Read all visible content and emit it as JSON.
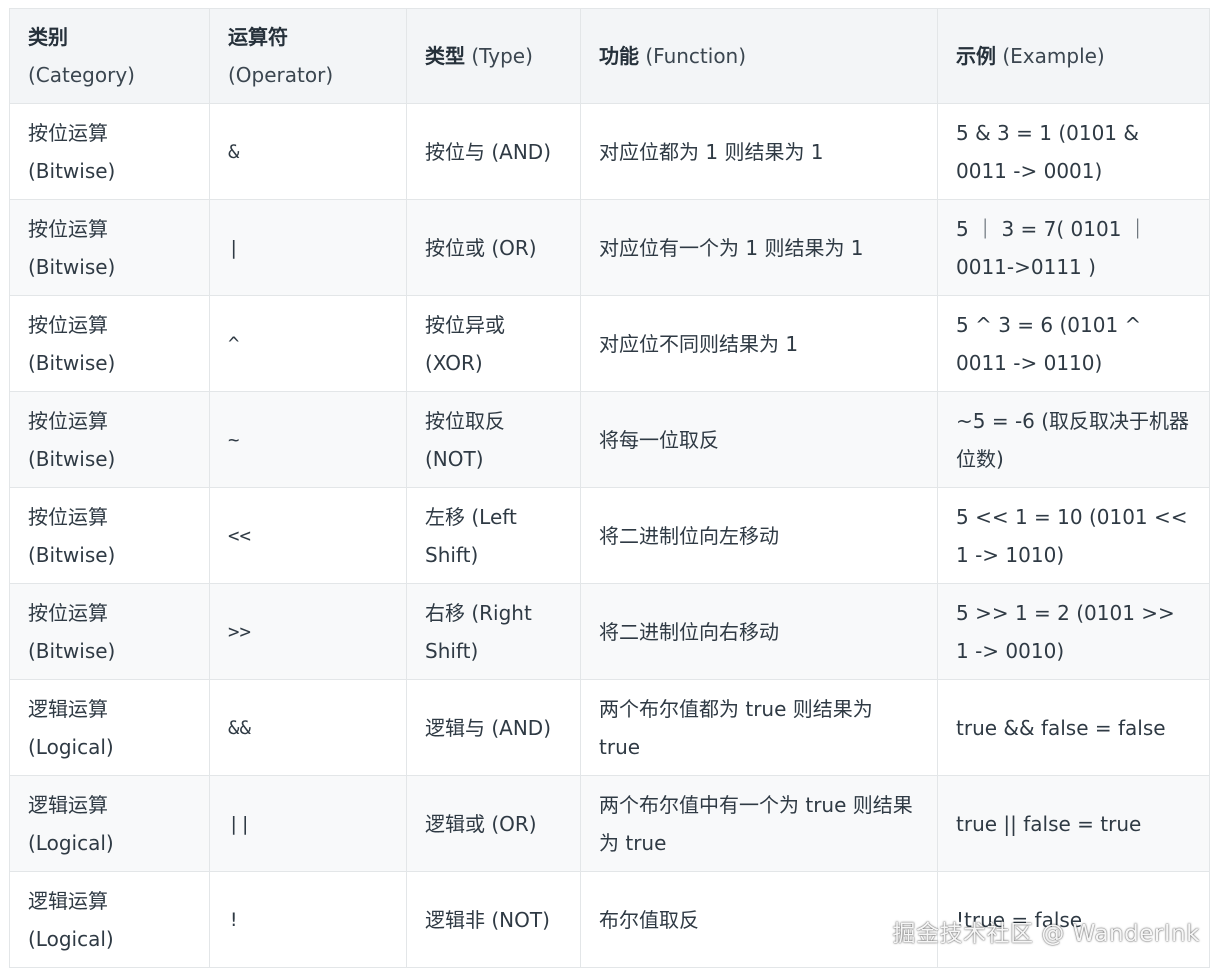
{
  "table": {
    "headers": {
      "category_zh": "类别",
      "category_en": "(Category)",
      "operator_zh": "运算符",
      "operator_en": "(Operator)",
      "type_zh": "类型",
      "type_en": "(Type)",
      "function_zh": "功能",
      "function_en": "(Function)",
      "example_zh": "示例",
      "example_en": "(Example)"
    },
    "rows": [
      {
        "category_zh": "按位运算",
        "category_en": "(Bitwise)",
        "operator": "&",
        "type": "按位与 (AND)",
        "function": "对应位都为 1 则结果为 1",
        "example": "5 & 3 = 1 (0101 & 0011 -> 0001)"
      },
      {
        "category_zh": "按位运算",
        "category_en": "(Bitwise)",
        "operator": "|",
        "type": "按位或 (OR)",
        "function": "对应位有一个为 1 则结果为 1",
        "example": "5 ｜ 3 = 7( 0101 ｜ 0011->0111 )"
      },
      {
        "category_zh": "按位运算",
        "category_en": "(Bitwise)",
        "operator": "^",
        "type": "按位异或 (XOR)",
        "function": "对应位不同则结果为 1",
        "example": "5 ^ 3 = 6 (0101 ^ 0011 -> 0110)"
      },
      {
        "category_zh": "按位运算",
        "category_en": "(Bitwise)",
        "operator": "~",
        "type": "按位取反 (NOT)",
        "function": "将每一位取反",
        "example": "~5 = -6 (取反取决于机器位数)"
      },
      {
        "category_zh": "按位运算",
        "category_en": "(Bitwise)",
        "operator": "<<",
        "type": "左移 (Left Shift)",
        "function": "将二进制位向左移动",
        "example": "5 << 1 = 10 (0101 << 1 -> 1010)"
      },
      {
        "category_zh": "按位运算",
        "category_en": "(Bitwise)",
        "operator": ">>",
        "type": "右移 (Right Shift)",
        "function": "将二进制位向右移动",
        "example": "5 >> 1 = 2 (0101 >> 1 -> 0010)"
      },
      {
        "category_zh": "逻辑运算",
        "category_en": "(Logical)",
        "operator": "&&",
        "type": "逻辑与 (AND)",
        "function": "两个布尔值都为 true 则结果为 true",
        "example": "true && false = false"
      },
      {
        "category_zh": "逻辑运算",
        "category_en": "(Logical)",
        "operator": "||",
        "type": "逻辑或 (OR)",
        "function": "两个布尔值中有一个为 true 则结果为 true",
        "example": "true || false = true"
      },
      {
        "category_zh": "逻辑运算",
        "category_en": "(Logical)",
        "operator": "!",
        "type": "逻辑非 (NOT)",
        "function": "布尔值取反",
        "example": "!true = false"
      }
    ]
  },
  "watermark": "掘金技术社区 @ WanderInk"
}
